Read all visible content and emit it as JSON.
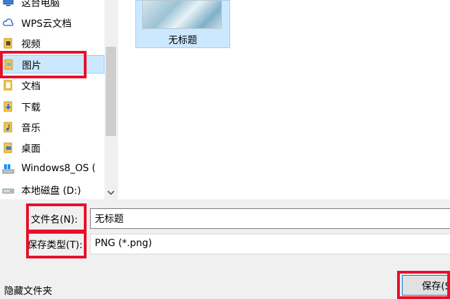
{
  "nav": {
    "items": [
      {
        "label": "这台电脑",
        "icon": "computer-icon"
      },
      {
        "label": "WPS云文档",
        "icon": "cloud-icon"
      },
      {
        "label": "视频",
        "icon": "video-folder-icon"
      },
      {
        "label": "图片",
        "icon": "pictures-folder-icon",
        "selected": true
      },
      {
        "label": "文档",
        "icon": "documents-folder-icon"
      },
      {
        "label": "下载",
        "icon": "downloads-folder-icon"
      },
      {
        "label": "音乐",
        "icon": "music-folder-icon"
      },
      {
        "label": "桌面",
        "icon": "desktop-folder-icon"
      },
      {
        "label": "Windows8_OS (",
        "icon": "windows-drive-icon"
      },
      {
        "label": "本地磁盘 (D:)",
        "icon": "drive-icon"
      }
    ]
  },
  "content": {
    "file": {
      "name": "无标题"
    }
  },
  "form": {
    "filename_label": "文件名(N):",
    "filename_value": "无标题",
    "filetype_label": "保存类型(T):",
    "filetype_value": "PNG (*.png)"
  },
  "footer": {
    "hide_folders": "隐藏文件夹",
    "save_label": "保存(S)"
  },
  "colors": {
    "highlight": "#e5102a",
    "selection": "#cce8ff",
    "accent": "#0078d7"
  }
}
